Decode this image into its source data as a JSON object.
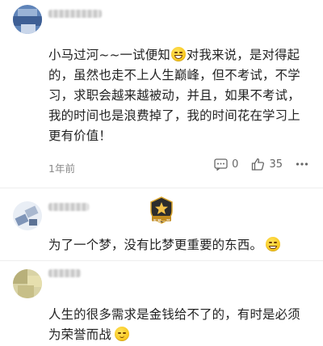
{
  "comments": [
    {
      "text_before_emoji": "小马过河~~一试便知",
      "text_after_emoji": "对我来说，是对得起的，虽然也走不上人生巅峰，但不考试，不学习，求职会越来越被动，并且，如果不考试，我的时间也是浪费掉了，我的时间花在学习上更有价值！",
      "emoji_icon": "grin-emoji",
      "time": "1年前",
      "reply_count": "0",
      "like_count": "35"
    },
    {
      "text": "为了一个梦，没有比梦更重要的东西。",
      "emoji_icon": "smile-emoji",
      "badge_text": "青葱一草"
    },
    {
      "text": "人生的很多需求是金钱给不了的，有时是必须为荣誉而战",
      "emoji_icon": "blush-emoji"
    }
  ],
  "colors": {
    "text": "#222222",
    "meta": "#888888",
    "badge_gold": "#d9a42b"
  }
}
